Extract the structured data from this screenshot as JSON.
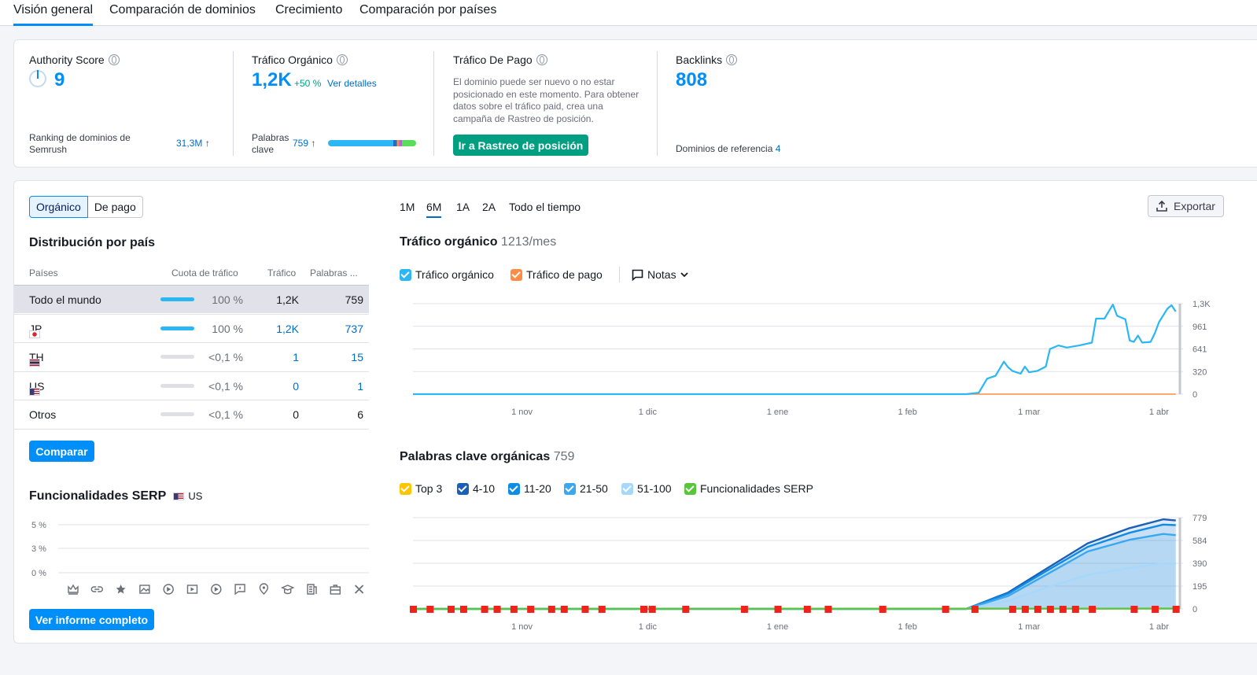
{
  "tabs": [
    "Visión general",
    "Comparación de dominios",
    "Crecimiento",
    "Comparación por países"
  ],
  "summary": {
    "authority": {
      "title": "Authority Score",
      "value": "9",
      "rank_label": "Ranking de dominios de Semrush",
      "rank_value": "31,3M",
      "rank_arrow": "↑"
    },
    "organic": {
      "title": "Tráfico Orgánico",
      "value": "1,2K",
      "change": "+50 %",
      "details": "Ver detalles",
      "kw_label": "Palabras clave",
      "kw_value": "759",
      "kw_arrow": "↑"
    },
    "paid": {
      "title": "Tráfico De Pago",
      "description": "El dominio puede ser nuevo o no estar posicionado en este momento. Para obtener datos sobre el tráfico paid, crea una campaña de Rastreo de posición.",
      "button": "Ir a Rastreo de posición"
    },
    "backlinks": {
      "title": "Backlinks",
      "value": "808",
      "ref_label": "Dominios de referencia",
      "ref_value": "4"
    }
  },
  "left": {
    "segments": [
      "Orgánico",
      "De pago"
    ],
    "distribution_title": "Distribución por país",
    "table": {
      "headers": [
        "Países",
        "Cuota de tráfico",
        "Tráfico",
        "Palabras ..."
      ],
      "rows": [
        {
          "name": "Todo el mundo",
          "flag": "",
          "share": "100 %",
          "share_value": 1.0,
          "traffic": "1,2K",
          "keywords": "759",
          "selected": true
        },
        {
          "name": "JP",
          "flag": "jp",
          "share": "100 %",
          "share_value": 1.0,
          "traffic": "1,2K",
          "keywords": "737"
        },
        {
          "name": "TH",
          "flag": "th",
          "share": "<0,1 %",
          "share_value": 0.001,
          "traffic": "1",
          "keywords": "15"
        },
        {
          "name": "US",
          "flag": "us",
          "share": "<0,1 %",
          "share_value": 0.001,
          "traffic": "0",
          "keywords": "1"
        },
        {
          "name": "Otros",
          "flag": "",
          "share": "<0,1 %",
          "share_value": 0.001,
          "traffic": "0",
          "keywords": "6"
        }
      ]
    },
    "compare_button": "Comparar",
    "serp": {
      "title": "Funcionalidades SERP",
      "country": "US",
      "yticks": [
        "5 %",
        "3 %",
        "0 %"
      ],
      "icons": [
        "crown-icon",
        "link-icon",
        "star-icon",
        "image-icon",
        "video-icon",
        "video-carousel-icon",
        "play-icon",
        "faq-icon",
        "local-pack-icon",
        "education-icon",
        "document-icon",
        "briefcase-icon",
        "x-icon"
      ]
    },
    "report_button": "Ver informe completo"
  },
  "right": {
    "periods": [
      "1M",
      "6M",
      "1A",
      "2A",
      "Todo el tiempo"
    ],
    "active_period": "6M",
    "export": "Exportar",
    "traffic_chart": {
      "title": "Tráfico orgánico",
      "subtitle": "1213/mes",
      "legend": [
        "Tráfico orgánico",
        "Tráfico de pago"
      ],
      "notes": "Notas"
    },
    "keywords_chart": {
      "title": "Palabras clave orgánicas",
      "subtitle": "759",
      "legend": [
        "Top 3",
        "4-10",
        "11-20",
        "21-50",
        "51-100",
        "Funcionalidades SERP"
      ]
    },
    "colors": {
      "organic": "#2bb7f5",
      "paid": "#ff8c43",
      "top3": "#ffc500",
      "r4_10": "#1a60b5",
      "r11_20": "#0f8ce4",
      "r21_50": "#3aa8f0",
      "r51_100": "#a5d8fa",
      "serp": "#59c53a",
      "accent": "#008ff8"
    }
  },
  "chart_data": [
    {
      "type": "line",
      "title": "Tráfico orgánico",
      "x_ticks": [
        "1 nov",
        "1 dic",
        "1 ene",
        "1 feb",
        "1 mar",
        "1 abr"
      ],
      "y_ticks": [
        "0",
        "320",
        "641",
        "961",
        "1,3K"
      ],
      "ylim": [
        0,
        1282
      ],
      "x_range": [
        "2023-10-06",
        "2024-04-06"
      ],
      "series": [
        {
          "name": "Tráfico orgánico",
          "color": "#2bb7f5",
          "points": [
            [
              "2023-10-06",
              0
            ],
            [
              "2024-02-15",
              0
            ],
            [
              "2024-02-18",
              20
            ],
            [
              "2024-02-20",
              220
            ],
            [
              "2024-02-22",
              260
            ],
            [
              "2024-02-24",
              460
            ],
            [
              "2024-02-25",
              380
            ],
            [
              "2024-02-26",
              330
            ],
            [
              "2024-02-28",
              290
            ],
            [
              "2024-02-29",
              390
            ],
            [
              "2024-03-01",
              310
            ],
            [
              "2024-03-03",
              330
            ],
            [
              "2024-03-05",
              390
            ],
            [
              "2024-03-06",
              640
            ],
            [
              "2024-03-08",
              690
            ],
            [
              "2024-03-10",
              660
            ],
            [
              "2024-03-13",
              690
            ],
            [
              "2024-03-16",
              730
            ],
            [
              "2024-03-17",
              1070
            ],
            [
              "2024-03-19",
              1070
            ],
            [
              "2024-03-21",
              1270
            ],
            [
              "2024-03-22",
              1110
            ],
            [
              "2024-03-24",
              1060
            ],
            [
              "2024-03-25",
              760
            ],
            [
              "2024-03-26",
              740
            ],
            [
              "2024-03-27",
              830
            ],
            [
              "2024-03-28",
              730
            ],
            [
              "2024-03-30",
              740
            ],
            [
              "2024-03-31",
              860
            ],
            [
              "2024-04-01",
              1020
            ],
            [
              "2024-04-03",
              1210
            ],
            [
              "2024-04-04",
              1260
            ],
            [
              "2024-04-05",
              1170
            ]
          ]
        },
        {
          "name": "Tráfico de pago",
          "color": "#ff8c43",
          "points": [
            [
              "2023-10-06",
              0
            ],
            [
              "2024-04-05",
              0
            ]
          ]
        }
      ]
    },
    {
      "type": "area",
      "title": "Palabras clave orgánicas",
      "x_ticks": [
        "1 nov",
        "1 dic",
        "1 ene",
        "1 feb",
        "1 mar",
        "1 abr"
      ],
      "y_ticks": [
        "0",
        "195",
        "390",
        "584",
        "779"
      ],
      "ylim": [
        0,
        779
      ],
      "x_range": [
        "2023-10-06",
        "2024-04-06"
      ],
      "series": [
        {
          "name": "Top 3",
          "color": "#ffc500",
          "points": [
            [
              "2023-10-06",
              0
            ],
            [
              "2024-04-05",
              5
            ]
          ]
        },
        {
          "name": "4-10",
          "color": "#1a60b5",
          "points": [
            [
              "2023-10-06",
              0
            ],
            [
              "2024-02-15",
              0
            ],
            [
              "2024-02-25",
              140
            ],
            [
              "2024-03-05",
              340
            ],
            [
              "2024-03-15",
              560
            ],
            [
              "2024-03-25",
              690
            ],
            [
              "2024-04-02",
              765
            ],
            [
              "2024-04-05",
              755
            ]
          ]
        },
        {
          "name": "11-20",
          "color": "#0f8ce4",
          "points": [
            [
              "2023-10-06",
              0
            ],
            [
              "2024-02-15",
              0
            ],
            [
              "2024-02-25",
              130
            ],
            [
              "2024-03-05",
              320
            ],
            [
              "2024-03-15",
              530
            ],
            [
              "2024-03-25",
              650
            ],
            [
              "2024-04-02",
              720
            ],
            [
              "2024-04-05",
              715
            ]
          ]
        },
        {
          "name": "21-50",
          "color": "#3aa8f0",
          "points": [
            [
              "2023-10-06",
              0
            ],
            [
              "2024-02-15",
              0
            ],
            [
              "2024-02-25",
              110
            ],
            [
              "2024-03-05",
              290
            ],
            [
              "2024-03-15",
              490
            ],
            [
              "2024-03-25",
              590
            ],
            [
              "2024-04-02",
              640
            ],
            [
              "2024-04-05",
              630
            ]
          ]
        },
        {
          "name": "51-100",
          "color": "#a5d8fa",
          "points": [
            [
              "2023-10-06",
              0
            ],
            [
              "2024-02-15",
              0
            ],
            [
              "2024-02-25",
              70
            ],
            [
              "2024-03-05",
              180
            ],
            [
              "2024-03-15",
              290
            ],
            [
              "2024-03-25",
              350
            ],
            [
              "2024-04-02",
              390
            ],
            [
              "2024-04-05",
              385
            ]
          ]
        },
        {
          "name": "Funcionalidades SERP",
          "color": "#59c53a",
          "points": [
            [
              "2023-10-06",
              0
            ],
            [
              "2024-04-05",
              3
            ]
          ]
        }
      ],
      "event_markers": [
        "2023-10-06",
        "2023-10-10",
        "2023-10-15",
        "2023-10-18",
        "2023-10-23",
        "2023-10-26",
        "2023-10-30",
        "2023-11-03",
        "2023-11-08",
        "2023-11-11",
        "2023-11-16",
        "2023-11-20",
        "2023-11-30",
        "2023-12-02",
        "2023-12-10",
        "2023-12-24",
        "2024-01-01",
        "2024-01-08",
        "2024-01-13",
        "2024-01-26",
        "2024-02-10",
        "2024-02-17",
        "2024-02-26",
        "2024-02-29",
        "2024-03-03",
        "2024-03-06",
        "2024-03-09",
        "2024-03-12",
        "2024-03-16",
        "2024-03-26",
        "2024-03-31",
        "2024-04-05"
      ]
    },
    {
      "type": "bar",
      "title": "Funcionalidades SERP",
      "y_ticks": [
        "0 %",
        "3 %",
        "5 %"
      ],
      "ylim": [
        0,
        5
      ],
      "categories": [
        "crown-icon",
        "link-icon",
        "star-icon",
        "image-icon",
        "video-icon",
        "video-carousel-icon",
        "play-icon",
        "faq-icon",
        "local-pack-icon",
        "education-icon",
        "document-icon",
        "briefcase-icon",
        "x-icon"
      ],
      "values": [
        0,
        0,
        0,
        0,
        0,
        0,
        0,
        0,
        0,
        0,
        0,
        0,
        0
      ]
    }
  ]
}
